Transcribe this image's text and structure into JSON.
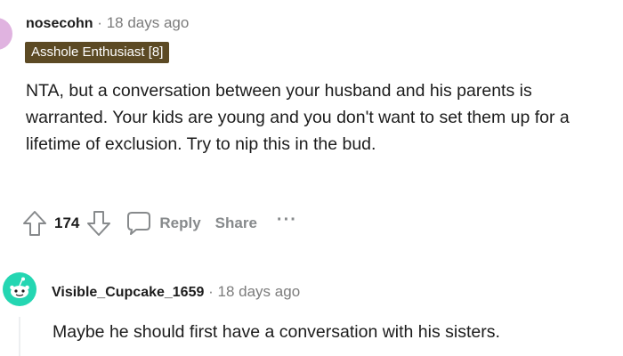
{
  "comment": {
    "author": "nosecohn",
    "separator": "·",
    "time": "18 days ago",
    "flair": "Asshole Enthusiast [8]",
    "body": "NTA, but a conversation between your husband and his parents is warranted. Your kids are young and you don't want to set them up for a lifetime of exclusion. Try to nip this in the bud.",
    "vote_count": "174",
    "actions": {
      "reply": "Reply",
      "share": "Share",
      "more": "···"
    },
    "icons": [
      "upvote-arrow-icon",
      "downvote-arrow-icon",
      "comment-bubble-icon",
      "more-dots-icon"
    ]
  },
  "reply": {
    "author": "Visible_Cupcake_1659",
    "separator": "·",
    "time": "18 days ago",
    "body": "Maybe he should first have a conversation with his sisters."
  },
  "colors": {
    "flair_bg": "#5c4a24",
    "avatar_top": "#e0b3e0",
    "avatar_reply": "#24d6b2",
    "meta_text": "#7c7c7c",
    "action_text": "#878a8c"
  }
}
